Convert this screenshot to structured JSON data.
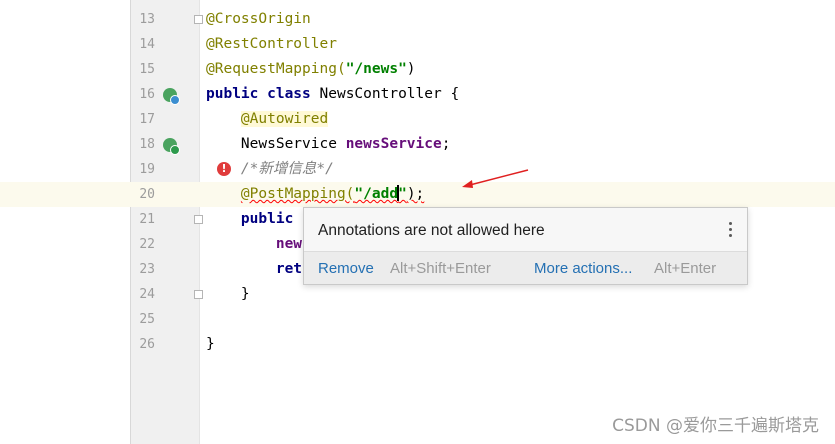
{
  "editor": {
    "lines": [
      {
        "num": "13",
        "segments": [
          {
            "text": "@CrossOrigin",
            "cls": "ann"
          }
        ]
      },
      {
        "num": "14",
        "segments": [
          {
            "text": "@RestController",
            "cls": "ann"
          }
        ]
      },
      {
        "num": "15",
        "segments": [
          {
            "text": "@RequestMapping(",
            "cls": "ann"
          },
          {
            "text": "\"/news\"",
            "cls": "str"
          },
          {
            "text": ")",
            "cls": ""
          }
        ]
      },
      {
        "num": "16",
        "segments": [
          {
            "text": "public class ",
            "cls": "kw"
          },
          {
            "text": "NewsController {",
            "cls": ""
          }
        ]
      },
      {
        "num": "17",
        "segments": [
          {
            "text": "    ",
            "cls": ""
          },
          {
            "text": "@Autowired",
            "cls": "ann autow"
          }
        ]
      },
      {
        "num": "18",
        "segments": [
          {
            "text": "    NewsService ",
            "cls": ""
          },
          {
            "text": "newsService",
            "cls": "fld"
          },
          {
            "text": ";",
            "cls": ""
          }
        ]
      },
      {
        "num": "19",
        "segments": [
          {
            "text": "    /*新增信息*/",
            "cls": "cmt"
          }
        ]
      },
      {
        "num": "20",
        "segments": [
          {
            "text": "    ",
            "cls": ""
          },
          {
            "text": "@PostMapping(",
            "cls": "ann err"
          },
          {
            "text": "\"/add",
            "cls": "str err"
          },
          {
            "text": "|",
            "cls": "caret"
          },
          {
            "text": "\"",
            "cls": "str err"
          },
          {
            "text": ");",
            "cls": "err"
          }
        ]
      },
      {
        "num": "21",
        "segments": [
          {
            "text": "    public",
            "cls": "kw"
          }
        ]
      },
      {
        "num": "22",
        "segments": [
          {
            "text": "        new",
            "cls": "fld"
          }
        ]
      },
      {
        "num": "23",
        "segments": [
          {
            "text": "        ret",
            "cls": "kw"
          }
        ]
      },
      {
        "num": "24",
        "segments": [
          {
            "text": "    }",
            "cls": ""
          }
        ]
      },
      {
        "num": "25",
        "segments": []
      },
      {
        "num": "26",
        "segments": [
          {
            "text": "}",
            "cls": ""
          }
        ]
      }
    ],
    "current_line": "20"
  },
  "error_popup": {
    "message": "Annotations are not allowed here",
    "remove_label": "Remove",
    "remove_shortcut": "Alt+Shift+Enter",
    "more_actions_label": "More actions...",
    "more_actions_shortcut": "Alt+Enter"
  },
  "gutter_icons": [
    "spring-bean-icon",
    "navigate-autowired-icon",
    "error-bulb-icon"
  ],
  "colors": {
    "accent": "#2470b3",
    "arrow": "#e02020",
    "error": "#ff0000"
  },
  "watermark": "CSDN @爱你三千遍斯塔克"
}
